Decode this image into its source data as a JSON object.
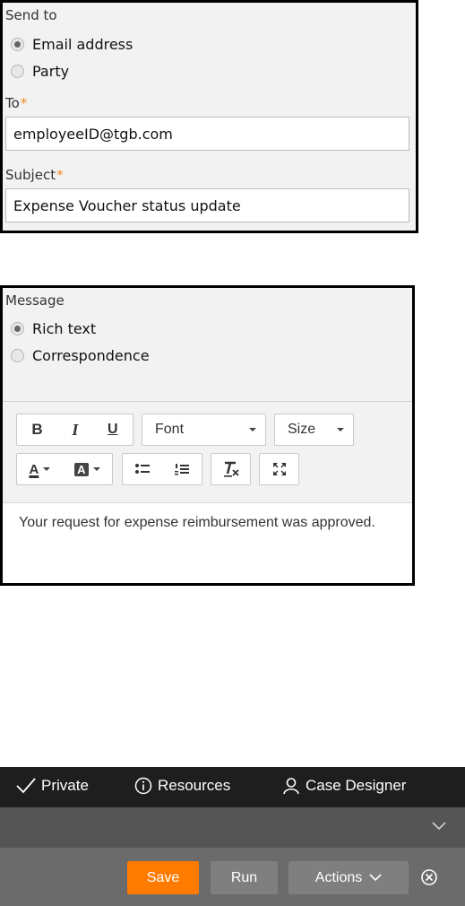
{
  "send_to": {
    "label": "Send to",
    "options": [
      {
        "label": "Email address",
        "checked": true
      },
      {
        "label": "Party",
        "checked": false
      }
    ],
    "to_label": "To",
    "to_value": "employeeID@tgb.com",
    "subject_label": "Subject",
    "subject_value": "Expense Voucher status update",
    "required_marker": "*",
    "required_color": "#f08a24"
  },
  "message": {
    "label": "Message",
    "options": [
      {
        "label": "Rich text",
        "checked": true
      },
      {
        "label": "Correspondence",
        "checked": false
      }
    ],
    "toolbar": {
      "bold": "B",
      "italic": "I",
      "underline": "U",
      "font_dropdown": "Font",
      "size_dropdown": "Size",
      "text_color": "A",
      "bg_color": "A"
    },
    "body": "Your request for expense reimbursement was approved."
  },
  "footer": {
    "nav": [
      {
        "label": "Private",
        "icon": "check-icon"
      },
      {
        "label": "Resources",
        "icon": "info-circle-icon"
      },
      {
        "label": "Case Designer",
        "icon": "user-icon"
      }
    ],
    "buttons": {
      "save": "Save",
      "run": "Run",
      "actions": "Actions"
    },
    "colors": {
      "save": "#ff7b00",
      "nav_bg": "#1e1e1e",
      "action_bg": "#6b6b6b"
    }
  }
}
